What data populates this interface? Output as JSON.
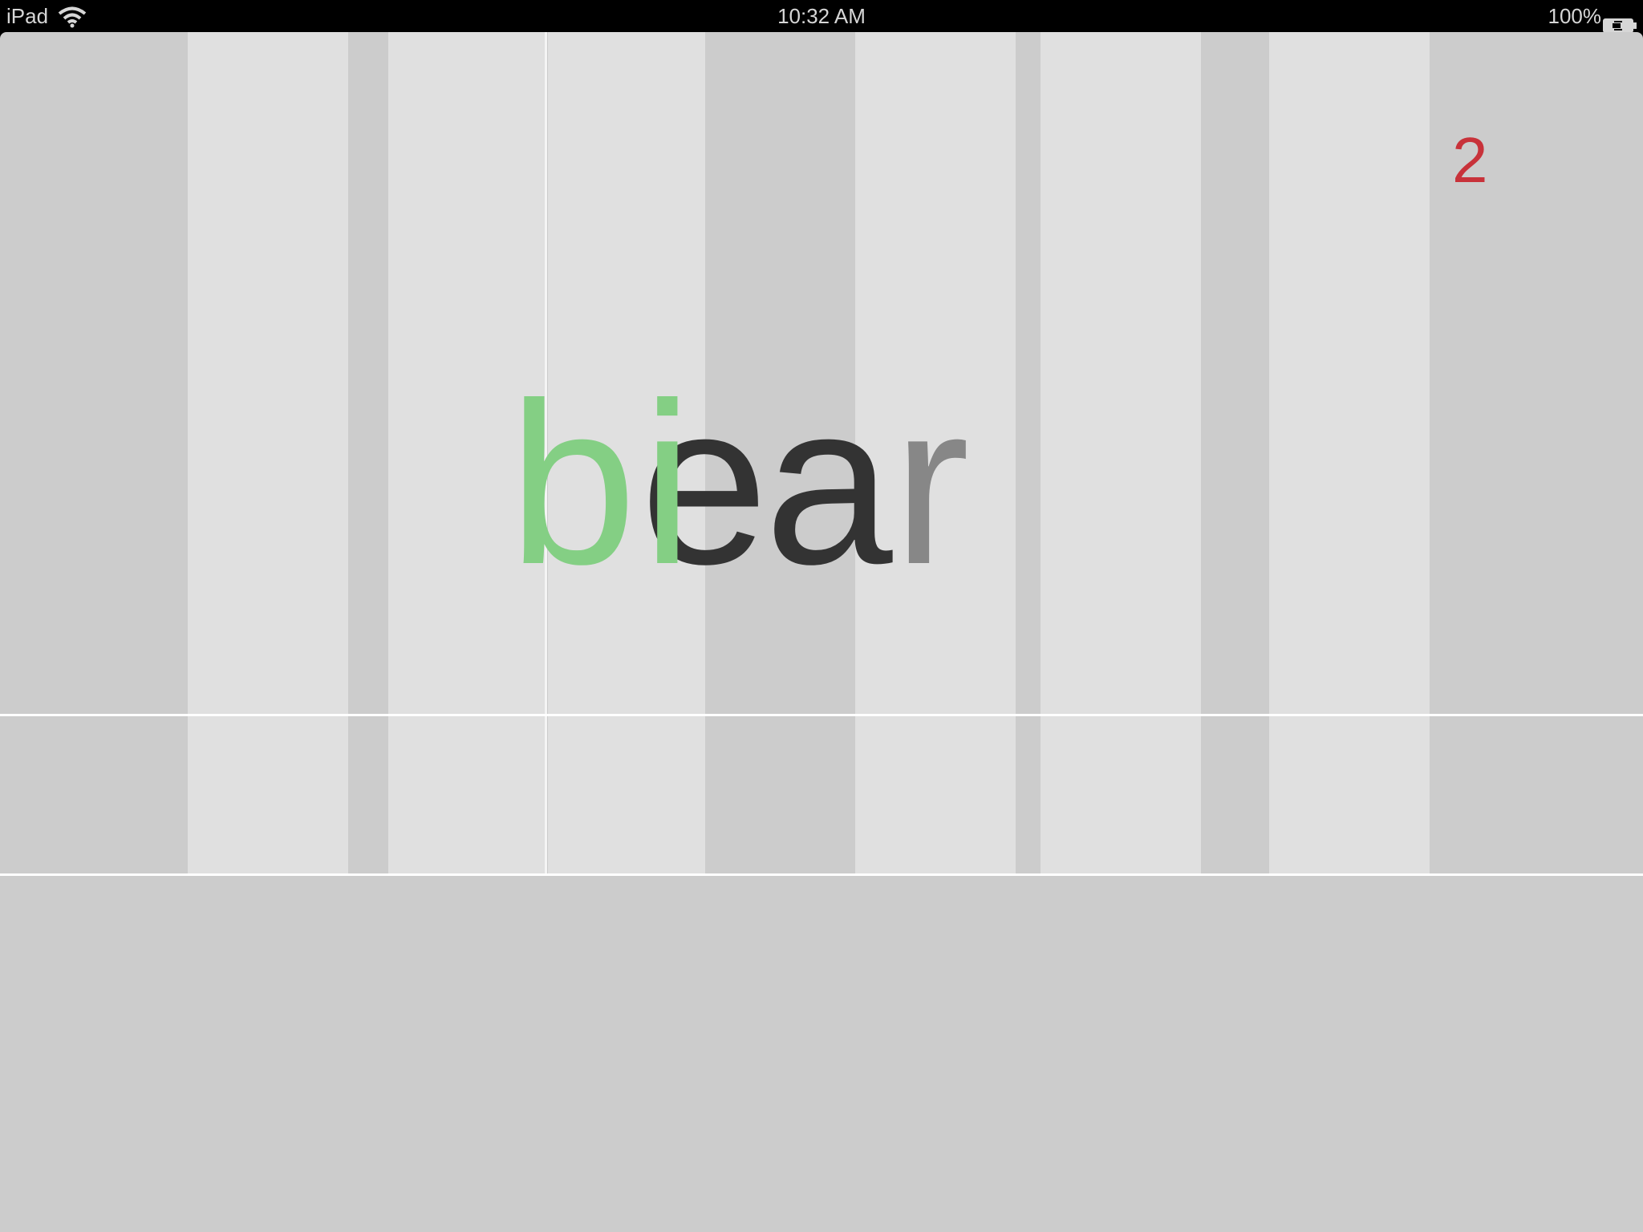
{
  "status_bar": {
    "device": "iPad",
    "time": "10:32 AM",
    "battery": "100%",
    "wifi_icon": "wifi-icon",
    "battery_icon": "battery-charging-icon"
  },
  "game": {
    "counter": "2",
    "counter_color": "#c8323a",
    "word_target": {
      "letters": [
        "b",
        "e",
        "a",
        "r"
      ],
      "text": "bear"
    },
    "word_overlay": {
      "letters": [
        "b",
        "i"
      ],
      "text": "bi",
      "color": "#84cf84"
    },
    "colors": {
      "background": "#cccccc",
      "column": "#e0e0e0",
      "letter_dark": "#333333",
      "letter_mid": "#878787",
      "green": "#84cf84"
    }
  }
}
